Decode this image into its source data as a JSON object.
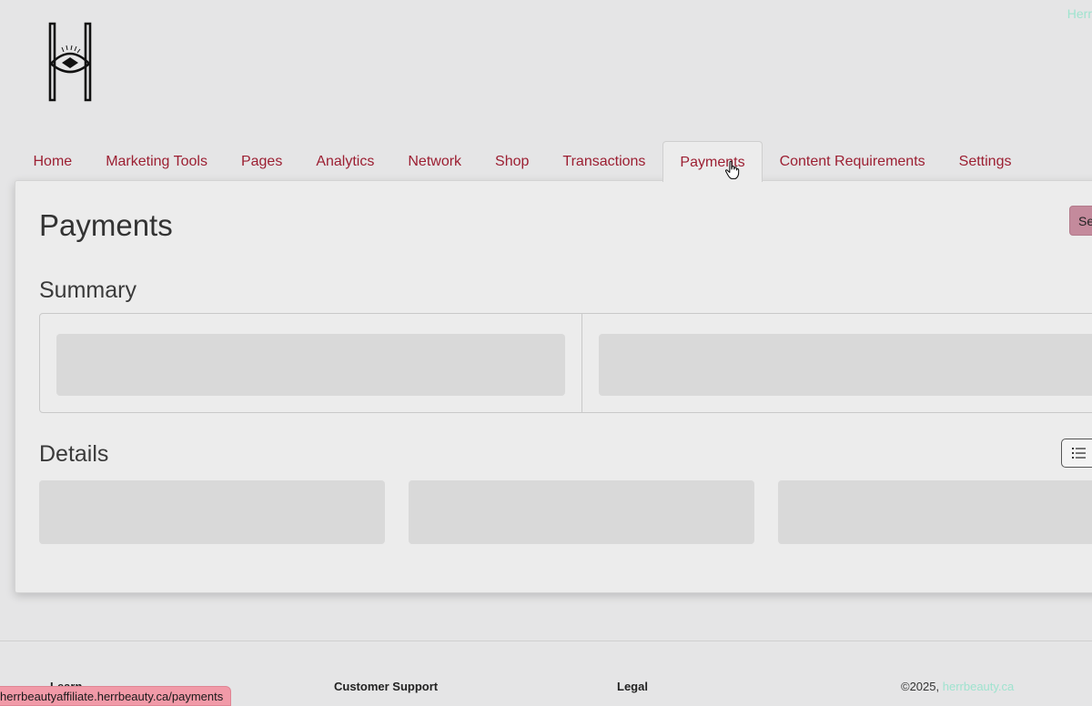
{
  "header": {
    "top_right_link": "Herr"
  },
  "nav": {
    "tabs": [
      {
        "label": "Home"
      },
      {
        "label": "Marketing Tools"
      },
      {
        "label": "Pages"
      },
      {
        "label": "Analytics"
      },
      {
        "label": "Network"
      },
      {
        "label": "Shop"
      },
      {
        "label": "Transactions"
      },
      {
        "label": "Payments",
        "active": true
      },
      {
        "label": "Content Requirements"
      },
      {
        "label": "Settings"
      }
    ]
  },
  "main": {
    "page_title": "Payments",
    "corner_button_label": "Se",
    "summary_title": "Summary",
    "details_title": "Details"
  },
  "footer": {
    "col1_title": "Learn",
    "col2_title": "Customer Support",
    "col3_title": "Legal",
    "copyright_prefix": "©2025, ",
    "copyright_link": "herrbeauty.ca"
  },
  "status_bar": {
    "url": "herrbeautyaffiliate.herrbeauty.ca/payments"
  },
  "colors": {
    "accent_text": "#9c1f32",
    "button_pink": "#c48a9c",
    "link_mint": "#9fe3cf",
    "status_pink": "#f19aa8"
  },
  "icons": {
    "logo": "h-eye-logo",
    "list_toggle": "list-icon",
    "cursor": "hand-pointer-icon"
  }
}
